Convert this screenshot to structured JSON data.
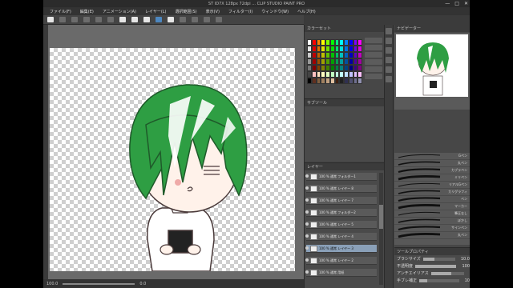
{
  "window": {
    "title": "ST ID7X 128px 72dpi ... CLIP STUDIO PAINT PRO",
    "controls": [
      "—",
      "□",
      "✕"
    ]
  },
  "menu": [
    "ファイル(F)",
    "編集(E)",
    "アニメーション(A)",
    "レイヤー(L)",
    "選択範囲(S)",
    "表示(V)",
    "フィルター(I)",
    "ウィンドウ(W)",
    "ヘルプ(H)"
  ],
  "colors": {
    "hair": "#2e9e43",
    "hairDark": "#1f7a31",
    "skin": "#fff2ea",
    "outline": "#4a3a3a",
    "selectedLayer": "#8aa0b8"
  },
  "palette_swatches": [
    "#ffffff",
    "#ff0000",
    "#ff8000",
    "#ffff00",
    "#80ff00",
    "#00ff00",
    "#00ff80",
    "#00ffff",
    "#0080ff",
    "#0000ff",
    "#8000ff",
    "#ff00ff",
    "#e6e6e6",
    "#e00000",
    "#e07000",
    "#e0e000",
    "#70e000",
    "#00e000",
    "#00e070",
    "#00e0e0",
    "#0070e0",
    "#0000e0",
    "#7000e0",
    "#e000e0",
    "#cccccc",
    "#c00000",
    "#c06000",
    "#c0c000",
    "#60c000",
    "#00c000",
    "#00c060",
    "#00c0c0",
    "#0060c0",
    "#0000c0",
    "#6000c0",
    "#c000c0",
    "#999999",
    "#a00000",
    "#a05000",
    "#a0a000",
    "#50a000",
    "#00a000",
    "#00a050",
    "#00a0a0",
    "#0050a0",
    "#0000a0",
    "#5000a0",
    "#a000a0",
    "#777777",
    "#800000",
    "#804000",
    "#808000",
    "#408000",
    "#008000",
    "#008040",
    "#008080",
    "#004080",
    "#000080",
    "#400080",
    "#800080",
    "#444444",
    "#ffc0c0",
    "#ffe0c0",
    "#ffffc0",
    "#e0ffc0",
    "#c0ffc0",
    "#c0ffe0",
    "#c0ffff",
    "#c0e0ff",
    "#c0c0ff",
    "#e0c0ff",
    "#ffc0ff",
    "#000000",
    "#603020",
    "#806040",
    "#a08060",
    "#c0a080",
    "#e0c0a0",
    "#402010",
    "#202020",
    "#303050",
    "#505070",
    "#707090",
    "#9090b0"
  ],
  "panels": {
    "color_set_tab": "カラーセット",
    "subtool_tab": "サブツール",
    "layer_tab": "レイヤー",
    "tool_prop_tab": "ツールプロパティ",
    "navigator_tab": "ナビゲーター"
  },
  "layers": [
    {
      "name": "100 % 通常 フォルダー1",
      "selected": false
    },
    {
      "name": "100 % 通常 レイヤー 8",
      "selected": false
    },
    {
      "name": "100 % 通常 レイヤー 7",
      "selected": false
    },
    {
      "name": "100 % 通常 フォルダー2",
      "selected": false
    },
    {
      "name": "100 % 通常 レイヤー 5",
      "selected": false
    },
    {
      "name": "100 % 通常 レイヤー 4",
      "selected": false
    },
    {
      "name": "100 % 通常 レイヤー 3",
      "selected": true
    },
    {
      "name": "100 % 通常 レイヤー 2",
      "selected": false
    },
    {
      "name": "100 % 通常 用紙",
      "selected": false
    }
  ],
  "brushes": [
    "Gペン",
    "丸ペン",
    "カブラペン",
    "ミリペン",
    "リアルGペン",
    "カリグラフィ",
    "ペン",
    "マーカー",
    "筆圧なし",
    "ぼかし",
    "サインペン",
    "丸ペン"
  ],
  "tool_props": [
    {
      "label": "ブラシサイズ",
      "value": "10.0",
      "level": 0.35
    },
    {
      "label": "不透明度",
      "value": "100",
      "level": 1.0
    },
    {
      "label": "アンチエイリアス",
      "value": "",
      "level": 0.6
    },
    {
      "label": "手ブレ補正",
      "value": "10",
      "level": 0.2
    }
  ],
  "status": {
    "zoom": "100.0",
    "angle": "0.0"
  }
}
